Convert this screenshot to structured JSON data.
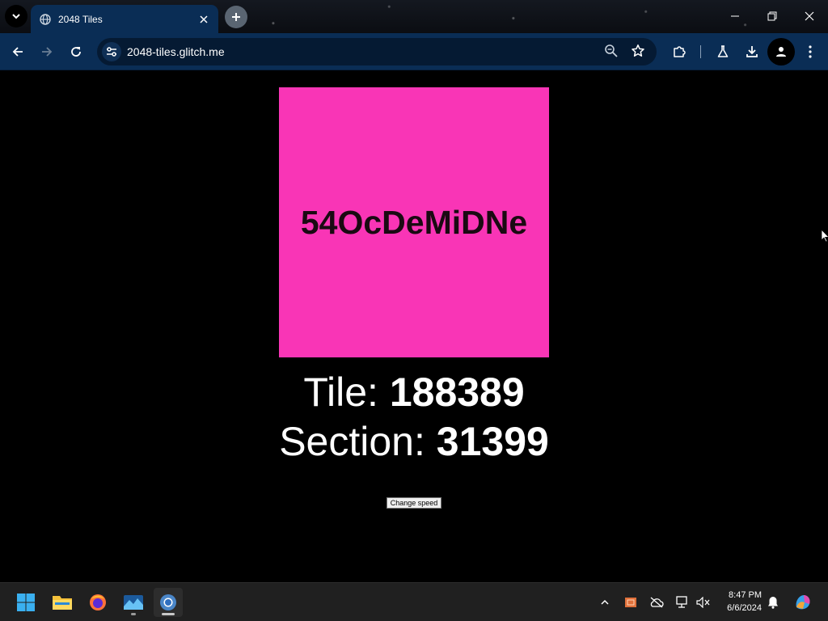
{
  "browser": {
    "tab_title": "2048 Tiles",
    "url": "2048-tiles.glitch.me"
  },
  "page": {
    "tile_text": "54OcDeMiDNe",
    "tile_color": "#f935b6",
    "tile_label": "Tile:",
    "tile_number": "188389",
    "section_label": "Section:",
    "section_number": "31399",
    "change_speed_label": "Change speed"
  },
  "taskbar": {
    "time": "8:47 PM",
    "date": "6/6/2024"
  },
  "icons": {
    "tab_search": "chevron-down-icon",
    "favicon": "globe-icon",
    "tab_close": "close-icon",
    "new_tab": "plus-icon",
    "back": "arrow-left-icon",
    "forward": "arrow-right-icon",
    "reload": "reload-icon",
    "site_info": "tune-icon",
    "zoom": "zoom-icon",
    "bookmark": "star-icon",
    "extensions": "puzzle-icon",
    "labs": "flask-icon",
    "downloads": "download-icon",
    "profile": "person-icon",
    "menu": "kebab-icon"
  }
}
